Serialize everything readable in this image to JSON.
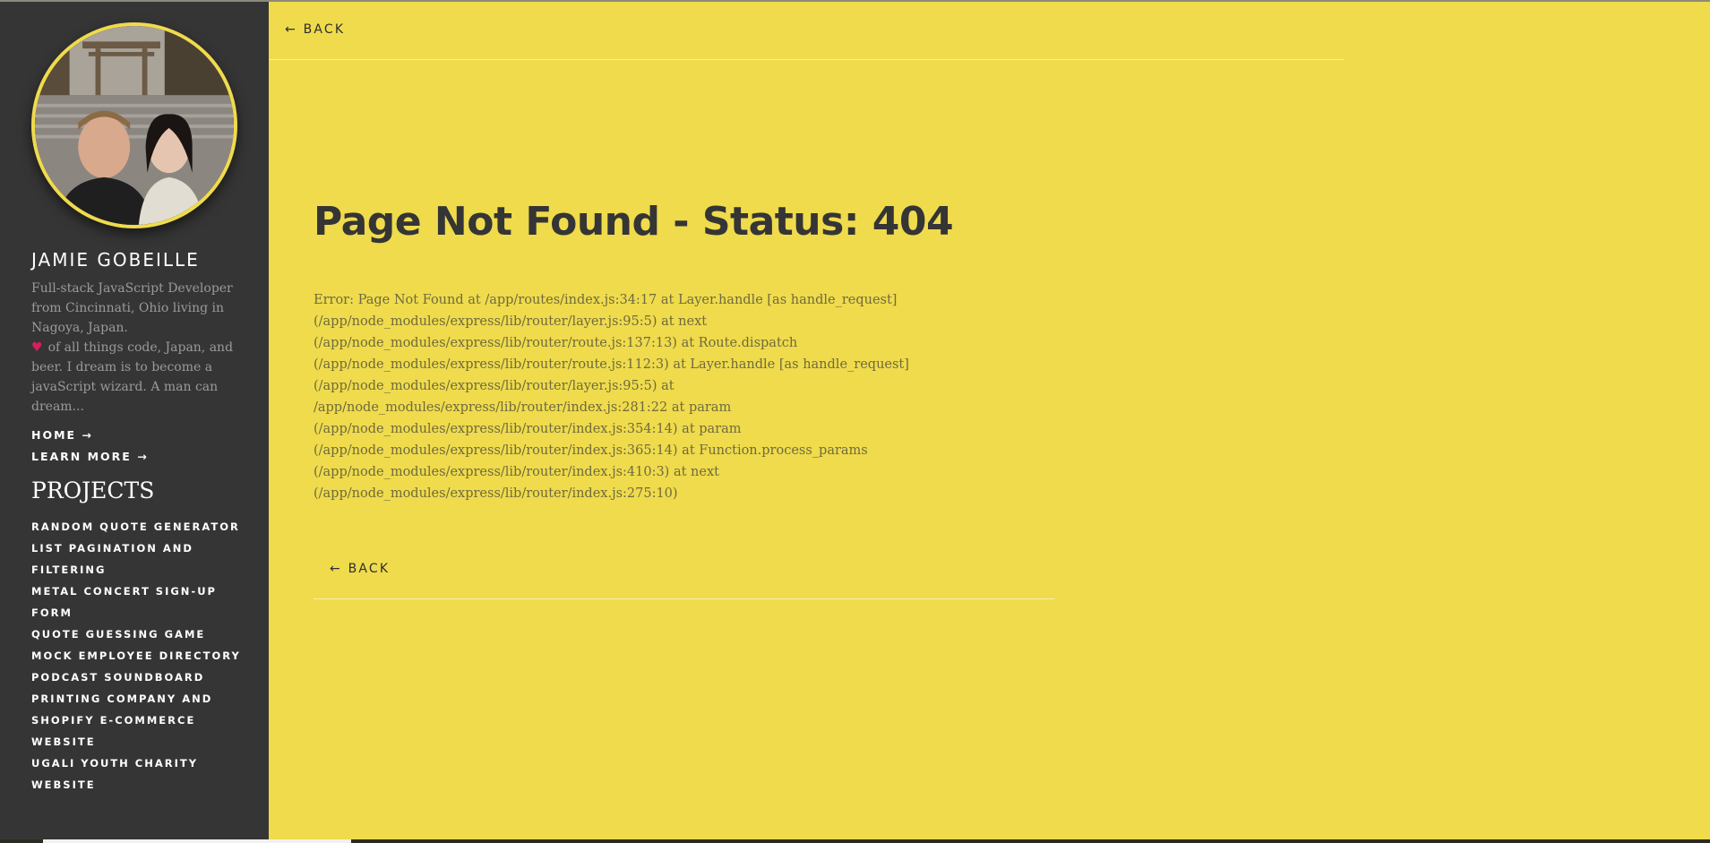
{
  "sidebar": {
    "name": "JAMIE GOBEILLE",
    "bio_lines": [
      "Full-stack JavaScript Developer",
      "from Cincinnati, Ohio living in",
      "Nagoya, Japan."
    ],
    "bio_heart_icon": "heart-icon",
    "bio_lines_2": [
      "of all things code, Japan, and",
      "beer. I dream is to become a",
      "javaScript wizard. A man can",
      "dream..."
    ],
    "home_link": "HOME →",
    "learn_more_link": "LEARN MORE →",
    "projects_title": "PROJECTS",
    "projects": [
      {
        "lines": [
          "RANDOM QUOTE GENERATOR"
        ]
      },
      {
        "lines": [
          "LIST PAGINATION AND",
          "FILTERING"
        ]
      },
      {
        "lines": [
          "METAL CONCERT SIGN-UP",
          "FORM"
        ]
      },
      {
        "lines": [
          "QUOTE GUESSING GAME"
        ]
      },
      {
        "lines": [
          "MOCK EMPLOYEE DIRECTORY"
        ]
      },
      {
        "lines": [
          "PODCAST SOUNDBOARD"
        ]
      },
      {
        "lines": [
          "PRINTING COMPANY AND",
          "SHOPIFY E-COMMERCE",
          "WEBSITE"
        ]
      },
      {
        "lines": [
          "UGALI YOUTH CHARITY",
          "WEBSITE"
        ]
      }
    ]
  },
  "main": {
    "top_back": "← BACK",
    "title": "Page Not Found - Status: 404",
    "stack_lines": [
      "Error: Page Not Found at /app/routes/index.js:34:17 at Layer.handle [as handle_request]",
      "(/app/node_modules/express/lib/router/layer.js:95:5) at next",
      "(/app/node_modules/express/lib/router/route.js:137:13) at Route.dispatch",
      "(/app/node_modules/express/lib/router/route.js:112:3) at Layer.handle [as handle_request]",
      "(/app/node_modules/express/lib/router/layer.js:95:5) at",
      "/app/node_modules/express/lib/router/index.js:281:22 at param",
      "(/app/node_modules/express/lib/router/index.js:354:14) at param",
      "(/app/node_modules/express/lib/router/index.js:365:14) at Function.process_params",
      "(/app/node_modules/express/lib/router/index.js:410:3) at next",
      "(/app/node_modules/express/lib/router/index.js:275:10)"
    ],
    "bottom_back": "← BACK"
  },
  "colors": {
    "background": "#efdb4c",
    "sidebar": "#353535",
    "heart": "#d61f5e",
    "title": "#353535"
  }
}
